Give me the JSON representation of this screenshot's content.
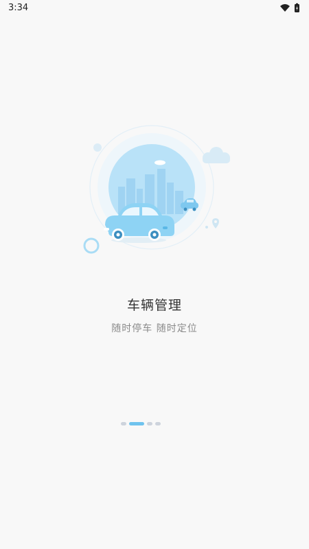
{
  "status_bar": {
    "time": "3:34",
    "icons": [
      "wifi-icon",
      "battery-icon"
    ]
  },
  "onboarding": {
    "title": "车辆管理",
    "subtitle": "随时停车 随时定位"
  },
  "pager": {
    "page_count": 4,
    "active_index": 1
  },
  "colors": {
    "background": "#f8f8f8",
    "accent": "#6fc3ee",
    "car": "#8ed3f4",
    "title": "#333333",
    "subtitle": "#8a8a8a",
    "dot_inactive": "#cdd3dc"
  }
}
